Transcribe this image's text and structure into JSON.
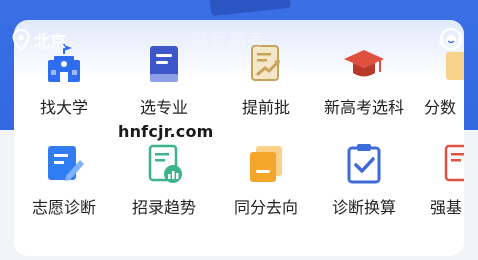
{
  "header": {
    "location": "北京",
    "watermark": "锦宏高考"
  },
  "overlay": {
    "url": "hnfcjr.com"
  },
  "grid": {
    "row1": [
      {
        "label": "找大学",
        "icon": "university-icon",
        "color": "#2f6df0"
      },
      {
        "label": "选专业",
        "icon": "book-icon",
        "color": "#3d57c9"
      },
      {
        "label": "提前批",
        "icon": "document-trend-icon",
        "color": "#c9a25a"
      },
      {
        "label": "新高考选科",
        "icon": "graduation-cap-icon",
        "color": "#e0503e"
      },
      {
        "label": "分数",
        "icon": "partial-icon",
        "color": "#f0b43a"
      }
    ],
    "row2": [
      {
        "label": "志愿诊断",
        "icon": "edit-document-icon",
        "color": "#2f7df0"
      },
      {
        "label": "招录趋势",
        "icon": "report-chart-icon",
        "color": "#3db38a"
      },
      {
        "label": "同分去向",
        "icon": "stacked-cards-icon",
        "color": "#f4a62a"
      },
      {
        "label": "诊断换算",
        "icon": "checklist-icon",
        "color": "#3d6bd8"
      },
      {
        "label": "强基",
        "icon": "partial-doc-icon",
        "color": "#e0503e"
      }
    ]
  },
  "pagination": {
    "pages": 2,
    "active": 1
  }
}
